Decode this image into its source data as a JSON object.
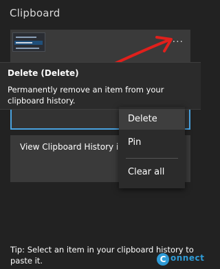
{
  "panel": {
    "title": "Clipboard"
  },
  "items": [
    {
      "type": "image",
      "more_label": "..."
    },
    {
      "type": "text",
      "text": "View Clipboard History in W"
    }
  ],
  "tooltip": {
    "title": "Delete (Delete)",
    "body": "Permanently remove an item from your clipboard history."
  },
  "context_menu": {
    "items": [
      "Delete",
      "Pin",
      "Clear all"
    ],
    "hovered": "Delete"
  },
  "footer": {
    "tip": "Tip: Select an item in your clipboard history to paste it."
  },
  "watermark": {
    "logo_text": "onnect",
    "logo_badge": "C"
  },
  "colors": {
    "background": "#222222",
    "item_bg": "#3a3a3a",
    "selection_border": "#4aa3e0",
    "annotation_arrow": "#e0201c",
    "logo": "#2f9bd6"
  }
}
